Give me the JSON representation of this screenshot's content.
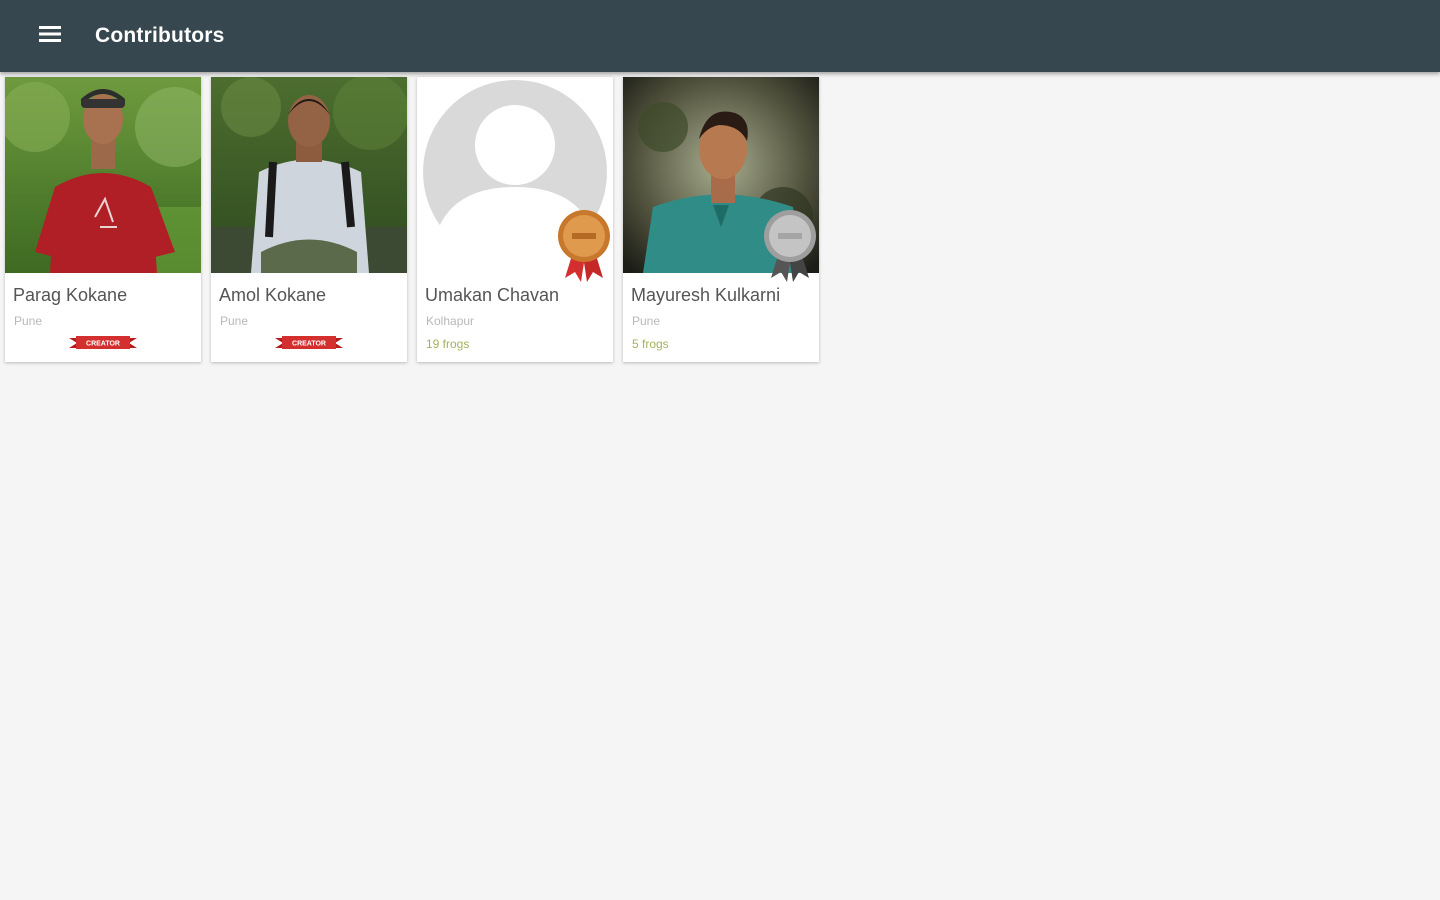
{
  "app": {
    "title": "Contributors",
    "menu_icon": "menu-icon"
  },
  "colors": {
    "appbar": "#37474f",
    "background": "#f5f5f5",
    "frogs_text": "#a3b45c",
    "ribbon": "#d32f2f",
    "bronze": "#d58a3a",
    "silver": "#a9a9a9"
  },
  "contributors": [
    {
      "name": "Parag Kokane",
      "city": "Pune",
      "badge": "creator-ribbon",
      "badge_text": "CREATOR"
    },
    {
      "name": "Amol Kokane",
      "city": "Pune",
      "badge": "creator-ribbon",
      "badge_text": "CREATOR"
    },
    {
      "name": "Umakan Chavan",
      "city": "Kolhapur",
      "frogs": "19 frogs",
      "medal": "bronze-medal-icon"
    },
    {
      "name": "Mayuresh Kulkarni",
      "city": "Pune",
      "frogs": "5 frogs",
      "medal": "silver-medal-icon"
    }
  ]
}
